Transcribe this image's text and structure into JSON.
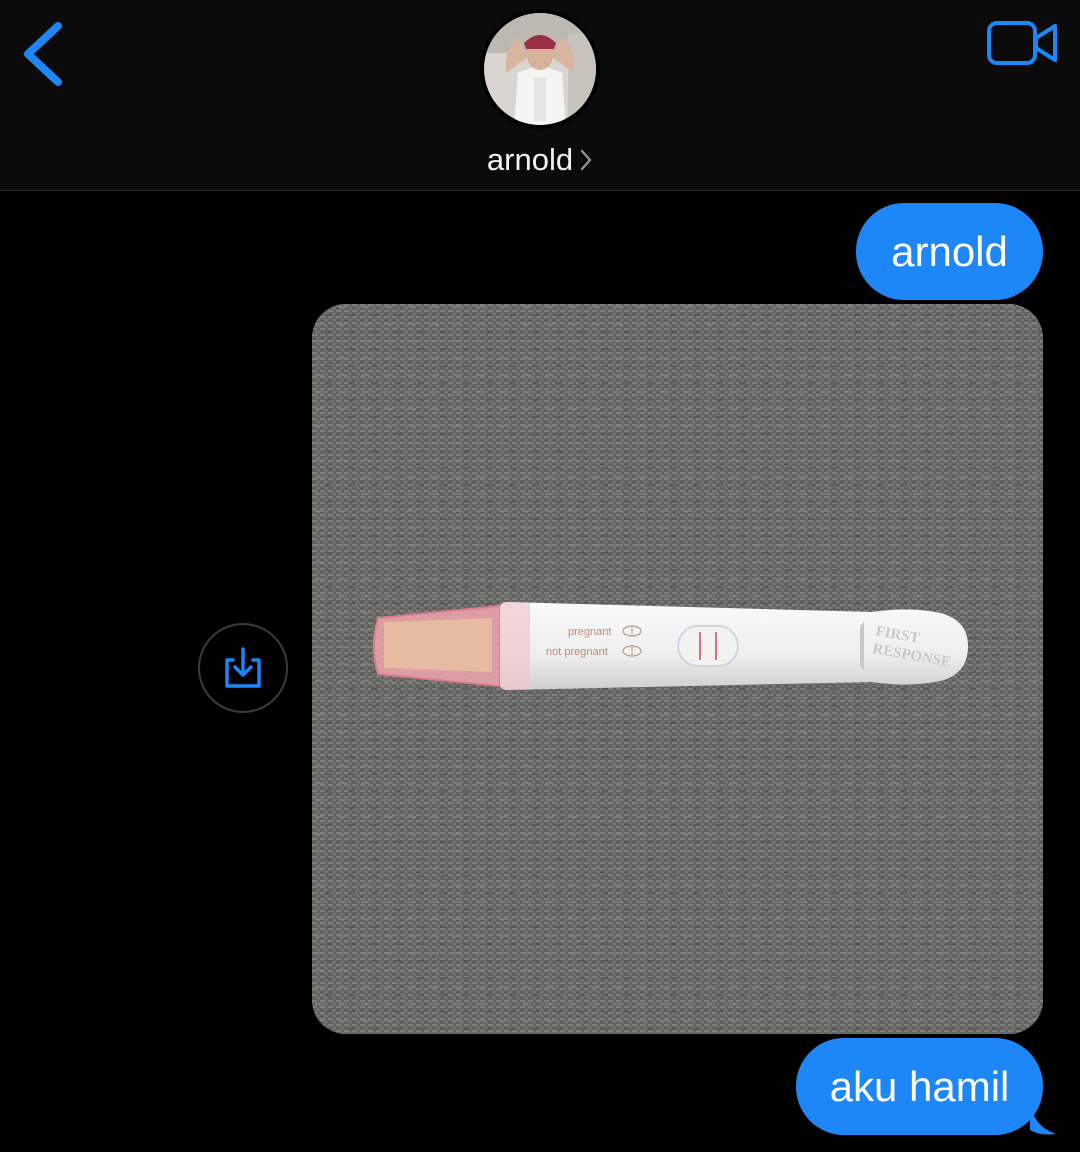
{
  "header": {
    "contact_name": "arnold"
  },
  "messages": [
    {
      "type": "text",
      "from": "me",
      "text": "arnold"
    },
    {
      "type": "image",
      "from": "me"
    },
    {
      "type": "text",
      "from": "me",
      "text": "aku hamil"
    }
  ],
  "photo": {
    "label_pregnant": "pregnant",
    "label_not_pregnant": "not pregnant",
    "brand_line1": "FIRST",
    "brand_line2": "RESPONSE"
  },
  "icons": {
    "back": "chevron-left-icon",
    "video": "video-camera-icon",
    "share": "share-download-icon",
    "contact_chevron": "chevron-right-icon"
  },
  "colors": {
    "accent": "#1e87f8",
    "bubble": "#1e87f8",
    "header_bg": "#0b0b0b",
    "background": "#000000"
  }
}
